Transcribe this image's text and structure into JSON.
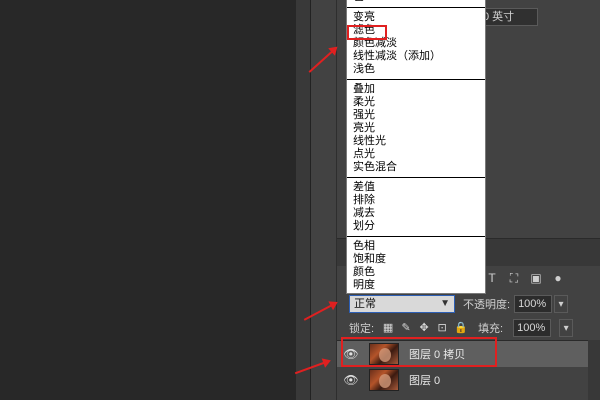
{
  "doc_size_field": "0 英寸",
  "blend_menu": {
    "partial_top": "色",
    "groups": [
      [
        "变亮",
        "滤色",
        "颜色减淡",
        "线性减淡（添加）",
        "浅色"
      ],
      [
        "叠加",
        "柔光",
        "强光",
        "亮光",
        "线性光",
        "点光",
        "实色混合"
      ],
      [
        "差值",
        "排除",
        "减去",
        "划分"
      ],
      [
        "色相",
        "饱和度",
        "颜色",
        "明度"
      ]
    ]
  },
  "layers_panel": {
    "blend_mode": "正常",
    "opacity_label": "不透明度:",
    "opacity_value": "100%",
    "lock_label": "锁定:",
    "fill_label": "填充:",
    "fill_value": "100%",
    "layers": [
      {
        "name": "图层 0 拷贝",
        "selected": true
      },
      {
        "name": "图层 0",
        "selected": false
      }
    ]
  },
  "icons": {
    "eye": "eye-icon",
    "text_filter": "T",
    "chevron": "chevron-down-icon"
  },
  "colors": {
    "annotation": "#e02020",
    "selection_border": "#2d5fb5"
  }
}
